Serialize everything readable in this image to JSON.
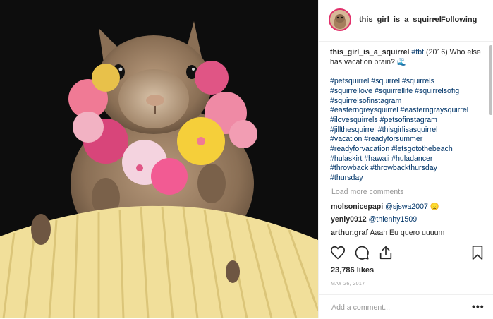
{
  "post": {
    "username": "this_girl_is_a_squirrel",
    "separator": "•",
    "follow_status": "Following"
  },
  "caption": {
    "username": "this_girl_is_a_squirrel",
    "tbt": "#tbt",
    "text_part1": "(2016) Who else has vacation brain?",
    "emoji": "🌊",
    "dot": ".",
    "hashtag_lines": [
      "#petsquirrel #squirrel #squirrels",
      "#squirrellove #squirrellife #squirrelsofig",
      "#squirrelsofinstagram",
      "#easterngreysquirrel #easterngraysquirrel",
      "#ilovesquirrels #petsofinstagram",
      "#jillthesquirrel #thisgirlisasquirrel",
      "#vacation #readyforsummer",
      "#readyforvacation #letsgotothebeach",
      "#hulaskirt #hawaii #huladancer",
      "#throwback #throwbackthursday",
      "#thursday"
    ]
  },
  "load_more": "Load more comments",
  "comments": [
    {
      "user": "molsonicepapi",
      "mention": "@sjswa2007",
      "emoji": "😞"
    },
    {
      "user": "yenly0912",
      "mention": "@thienhy1509",
      "text": ""
    },
    {
      "user": "arthur.graf",
      "mention": "",
      "text": "Aaah Eu quero uuuum"
    }
  ],
  "likes": "23,786 likes",
  "date": "MAY 26, 2017",
  "add_comment_placeholder": "Add a comment...",
  "more_options": "•••",
  "icons": [
    "heart-icon",
    "comment-icon",
    "share-icon",
    "bookmark-icon"
  ],
  "colors": {
    "link": "#003569",
    "text": "#262626",
    "muted": "#999999",
    "avatar_ring": "#e1306c"
  }
}
